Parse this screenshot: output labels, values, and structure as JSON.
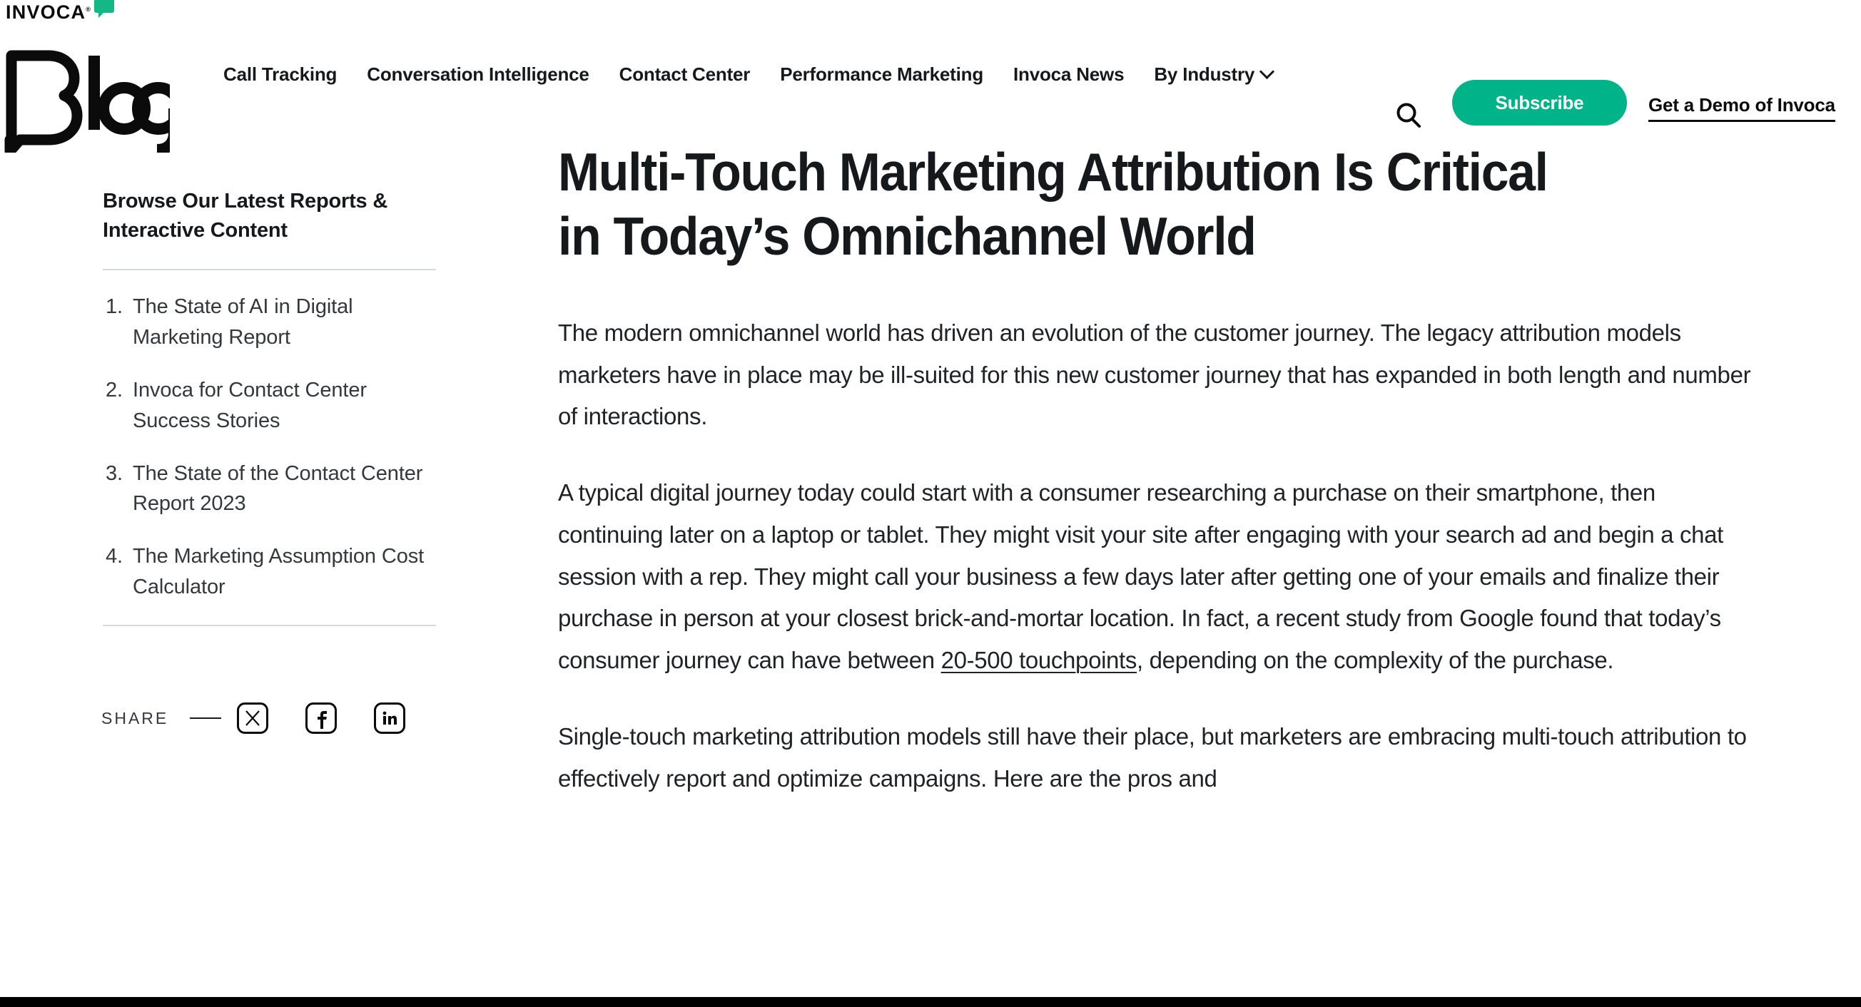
{
  "brand": {
    "logo_text": "INVOCA",
    "registered_mark": "®",
    "bubble_color": "#12b886",
    "blog_wordmark": "Blog"
  },
  "nav": {
    "items": [
      {
        "label": "Call Tracking",
        "has_dropdown": false
      },
      {
        "label": "Conversation Intelligence",
        "has_dropdown": false
      },
      {
        "label": "Contact Center",
        "has_dropdown": false
      },
      {
        "label": "Performance Marketing",
        "has_dropdown": false
      },
      {
        "label": "Invoca News",
        "has_dropdown": false
      },
      {
        "label": "By Industry",
        "has_dropdown": true
      }
    ],
    "search_icon": "search-icon",
    "subscribe_label": "Subscribe",
    "subscribe_color": "#00b388",
    "demo_link_label": "Get a Demo of Invoca"
  },
  "sidebar": {
    "title": "Browse Our Latest Reports & Interactive Content",
    "items": [
      {
        "number": "1.",
        "label": "The State of AI in Digital Marketing Report"
      },
      {
        "number": "2.",
        "label": "Invoca for Contact Center Success Stories"
      },
      {
        "number": "3.",
        "label": "The State of the Contact Center Report 2023"
      },
      {
        "number": "4.",
        "label": "The Marketing Assumption Cost Calculator"
      }
    ],
    "share": {
      "label": "SHARE",
      "networks": [
        {
          "name": "x-twitter-icon",
          "glyph": "X"
        },
        {
          "name": "facebook-icon",
          "glyph": "f"
        },
        {
          "name": "linkedin-icon",
          "glyph": "in"
        }
      ]
    }
  },
  "article": {
    "title": "Multi-Touch Marketing Attribution Is Critical in Today’s Omnichannel World",
    "paragraph_1": "The modern omnichannel world has driven an evolution of the customer journey. The legacy attribution models marketers have in place may be ill-suited for this new customer journey that has expanded in both length and number of interactions.",
    "paragraph_2_before_link": "A typical digital journey today could start with a consumer researching a purchase on their smartphone, then continuing later on a laptop or tablet. They might visit your site after engaging with your search ad and begin a chat session with a rep. They might call your business a few days later after getting one of your emails and finalize their purchase in person at your closest brick-and-mortar location. In fact, a recent study from Google found that today’s consumer journey can have between ",
    "paragraph_2_link": "20-500 touchpoints",
    "paragraph_2_after_link": ", depending on the complexity of the purchase.",
    "paragraph_3": "Single-touch marketing attribution models still have their place, but marketers are embracing multi-touch attribution to effectively report and optimize campaigns. Here are the pros and"
  }
}
